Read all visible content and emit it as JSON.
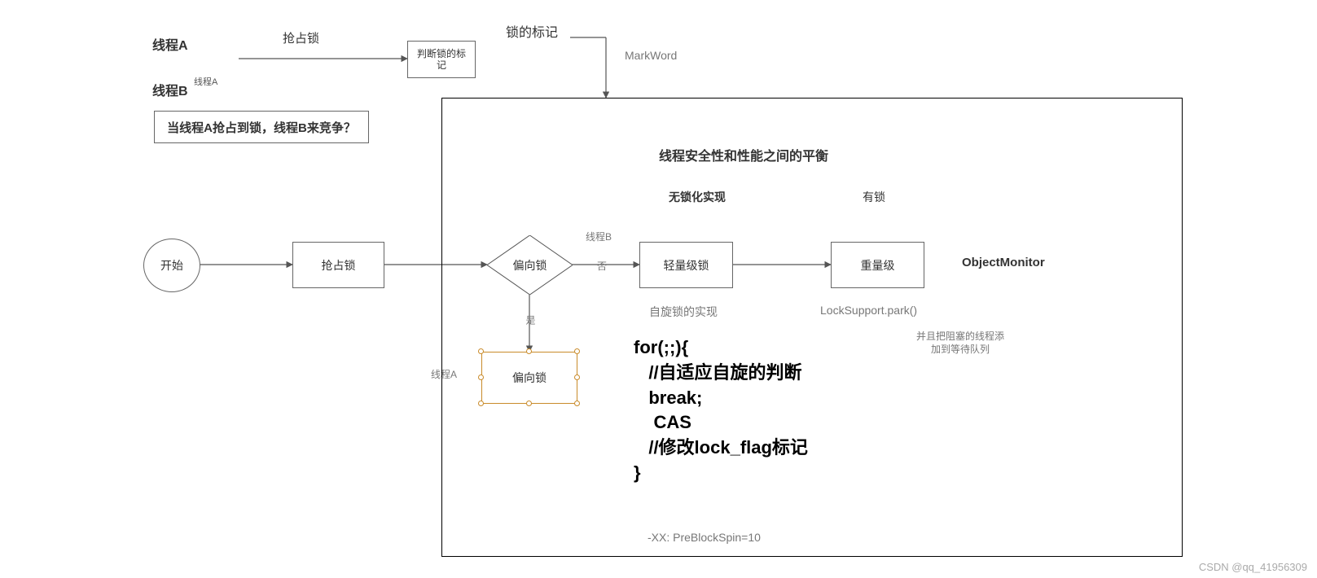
{
  "top": {
    "threadA": "线程A",
    "threadB": "线程B",
    "threadBSup": "线程A",
    "acquireLock": "抢占锁",
    "judgeBoxL1": "判断锁的标",
    "judgeBoxL2": "记",
    "lockMark": "锁的标记",
    "markWord": "MarkWord",
    "question": "当线程A抢占到锁，线程B来竞争？"
  },
  "flow": {
    "start": "开始",
    "acquire": "抢占锁",
    "biased": "偏向锁",
    "biased2": "偏向锁",
    "light": "轻量级锁",
    "heavy": "重量级",
    "edgeYes": "是",
    "edgeNo": "否",
    "edgeThreadA": "线程A",
    "edgeThreadB": "线程B"
  },
  "container": {
    "title": "线程安全性和性能之间的平衡",
    "lockFreeHeader": "无锁化实现",
    "hasLock": "有锁",
    "spinImpl": "自旋锁的实现",
    "lockSupport": "LockSupport.park()",
    "objectMonitor": "ObjectMonitor",
    "enqueueL1": "并且把阻塞的线程添",
    "enqueueL2": "加到等待队列",
    "code": "for(;;){\n   //自适应自旋的判断\n   break;\n    CAS\n   //修改lock_flag标记\n}",
    "preBlockSpin": "-XX: PreBlockSpin=10"
  },
  "watermark": "CSDN @qq_41956309"
}
